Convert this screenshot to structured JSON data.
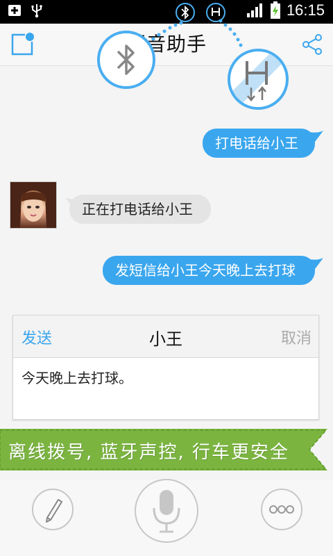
{
  "status_bar": {
    "time": "16:15",
    "icons": [
      "notification-plus-icon",
      "usb-icon",
      "bluetooth-icon",
      "hsp-h-icon",
      "signal-icon",
      "battery-charging-icon"
    ]
  },
  "header": {
    "title": "语音助手",
    "left_icon": "new-note-icon",
    "right_icon": "share-icon"
  },
  "overlays": {
    "bluetooth_badge_icon": "bluetooth-icon",
    "h_badge_icon": "h-transfer-icon"
  },
  "chat": {
    "messages": [
      {
        "side": "out",
        "text": "打电话给小王"
      },
      {
        "side": "in",
        "text": "正在打电话给小王"
      },
      {
        "side": "out",
        "text": "发短信给小王今天晚上去打球"
      }
    ]
  },
  "sms_card": {
    "send_label": "发送",
    "recipient": "小王",
    "cancel_label": "取消",
    "body": "今天晚上去打球。"
  },
  "banner": {
    "text": "离线拨号, 蓝牙声控, 行车更安全"
  },
  "bottom_bar": {
    "left_icon": "pencil-icon",
    "center_icon": "microphone-icon",
    "right_icon": "more-icon"
  },
  "colors": {
    "accent": "#3aa6ee",
    "bubble_in": "#e4e4e4",
    "banner_green": "#7bb540",
    "background": "#f4f4f4"
  }
}
